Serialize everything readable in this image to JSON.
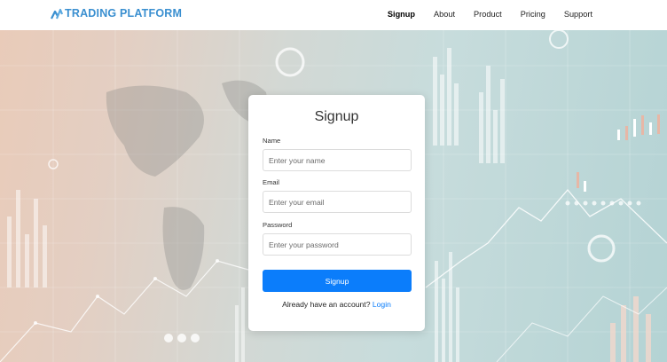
{
  "brand": {
    "name": "TRADING PLATFORM",
    "color": "#3a8fd0",
    "icon": "chart-logo-icon"
  },
  "nav": {
    "items": [
      {
        "label": "Signup",
        "active": true
      },
      {
        "label": "About"
      },
      {
        "label": "Product"
      },
      {
        "label": "Pricing"
      },
      {
        "label": "Support"
      }
    ]
  },
  "form": {
    "title": "Signup",
    "name": {
      "label": "Name",
      "placeholder": "Enter your name",
      "value": ""
    },
    "email": {
      "label": "Email",
      "placeholder": "Enter your email",
      "value": ""
    },
    "password": {
      "label": "Password",
      "placeholder": "Enter your password",
      "value": ""
    },
    "submit_label": "Signup",
    "login_prompt": "Already have an account?",
    "login_link": "Login",
    "accent": "#0b7dfb"
  }
}
